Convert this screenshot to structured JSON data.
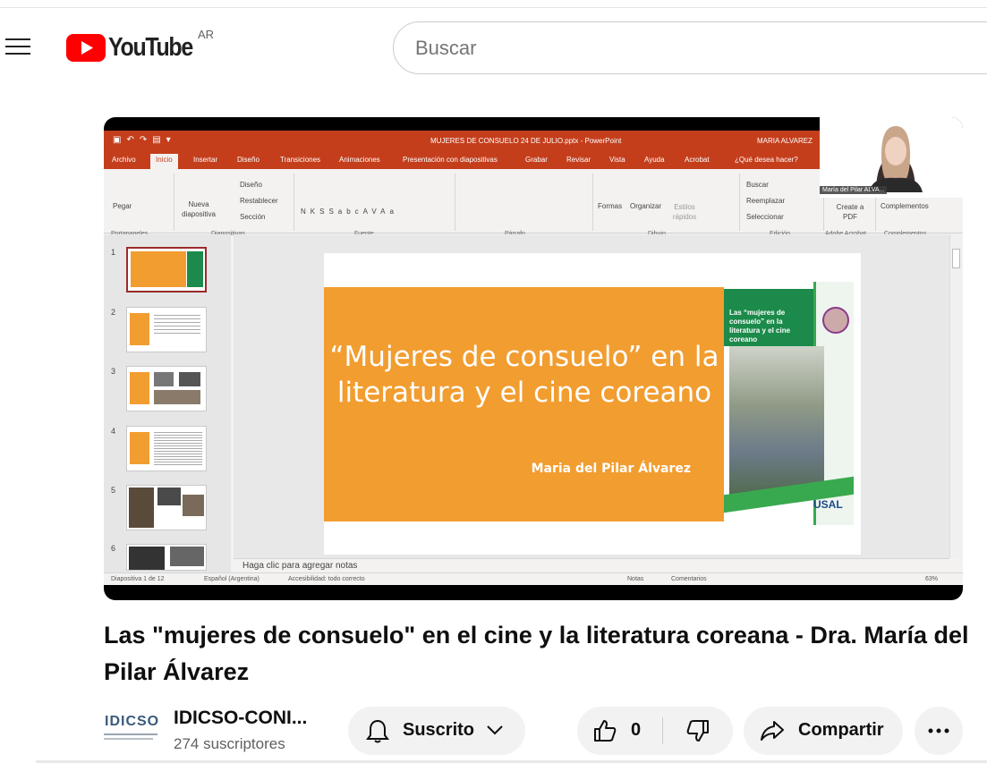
{
  "header": {
    "logo_text": "YouTube",
    "country_code": "AR",
    "search_placeholder": "Buscar"
  },
  "video_frame": {
    "ppt_window_title": "MUJERES DE CONSUELO 24 DE JULIO.pptx - PowerPoint",
    "ppt_user": "MARIA ALVAREZ",
    "ribbon_tabs": [
      "Archivo",
      "Inicio",
      "Insertar",
      "Diseño",
      "Transiciones",
      "Animaciones",
      "Presentación con diapositivas",
      "Grabar",
      "Revisar",
      "Vista",
      "Ayuda",
      "Acrobat",
      "¿Qué desea hacer?"
    ],
    "ribbon_items": {
      "paste": "Pegar",
      "new_slide": "Nueva diapositiva",
      "layout": "Diseño",
      "reset": "Restablecer",
      "section": "Sección",
      "shapes": "Formas",
      "arrange": "Organizar",
      "quick_styles": "Estilos rápidos",
      "find": "Buscar",
      "replace": "Reemplazar",
      "select": "Seleccionar",
      "create_pdf": "Create a PDF",
      "addins": "Complementos"
    },
    "ribbon_groups": [
      "Portapapeles",
      "Diapositivas",
      "Fuente",
      "Párrafo",
      "Dibujo",
      "Edición",
      "Adobe Acrobat",
      "Complementos"
    ],
    "slide_numbers": [
      "1",
      "2",
      "3",
      "4",
      "5",
      "6"
    ],
    "slide_title": "“Mujeres de consuelo” en la literatura y el cine coreano",
    "slide_author": "Maria del Pilar Álvarez",
    "poster_title": "Las “mujeres de consuelo” en la literatura y el cine coreano",
    "poster_logo": "USAL",
    "notes_placeholder": "Haga clic para agregar notas",
    "status_slide": "Diapositiva 1 de 12",
    "status_lang": "Español (Argentina)",
    "status_access": "Accesibilidad: todo correcto",
    "status_notes": "Notas",
    "status_comments": "Comentarios",
    "status_zoom": "63%",
    "webcam_label": "María del Pilar ALVA..."
  },
  "video": {
    "title": "Las \"mujeres de consuelo\" en el cine y la literatura coreana - Dra. María del Pilar Álvarez"
  },
  "channel": {
    "logo_text": "IDICSO",
    "name": "IDICSO-CONI...",
    "subscribers": "274 suscriptores"
  },
  "actions": {
    "subscribed_label": "Suscrito",
    "like_count": "0",
    "share_label": "Compartir"
  },
  "colors": {
    "youtube_red": "#ff0000",
    "ppt_red": "#c43e1c",
    "slide_orange": "#f29d30",
    "poster_green": "#1b8a4a"
  }
}
